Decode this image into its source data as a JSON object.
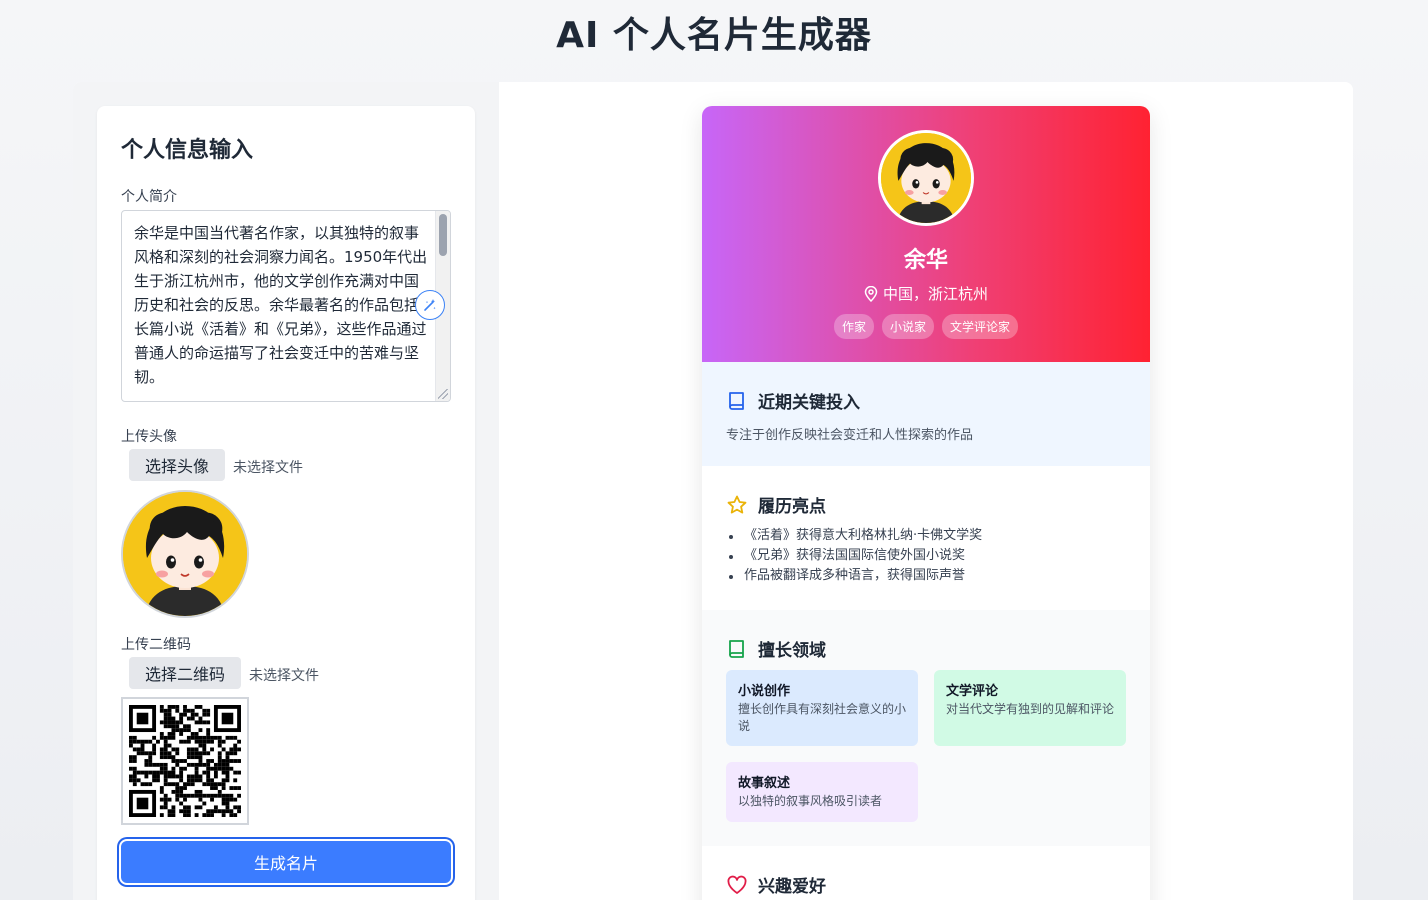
{
  "app": {
    "title": "AI 个人名片生成器"
  },
  "form": {
    "title": "个人信息输入",
    "bio_label": "个人简介",
    "bio_value": "余华是中国当代著名作家，以其独特的叙事风格和深刻的社会洞察力闻名。1950年代出生于浙江杭州市，他的文学创作充满对中国历史和社会的反思。余华最著名的作品包括长篇小说《活着》和《兄弟》，这些作品通过普通人的命运描写了社会变迁中的苦难与坚韧。",
    "avatar_label": "上传头像",
    "avatar_button": "选择头像",
    "avatar_status": "未选择文件",
    "qr_label": "上传二维码",
    "qr_button": "选择二维码",
    "qr_status": "未选择文件",
    "generate_button": "生成名片"
  },
  "card": {
    "name": "余华",
    "location": "中国，浙江杭州",
    "tags": [
      "作家",
      "小说家",
      "文学评论家"
    ],
    "focus": {
      "title": "近期关键投入",
      "text": "专注于创作反映社会变迁和人性探索的作品"
    },
    "highlights": {
      "title": "履历亮点",
      "items": [
        "《活着》获得意大利格林扎纳·卡佛文学奖",
        "《兄弟》获得法国国际信使外国小说奖",
        "作品被翻译成多种语言，获得国际声誉"
      ]
    },
    "skills": {
      "title": "擅长领域",
      "items": [
        {
          "name": "小说创作",
          "desc": "擅长创作具有深刻社会意义的小说"
        },
        {
          "name": "文学评论",
          "desc": "对当代文学有独到的见解和评论"
        },
        {
          "name": "故事叙述",
          "desc": "以独特的叙事风格吸引读者"
        }
      ]
    },
    "hobbies": {
      "title": "兴趣爱好"
    }
  },
  "colors": {
    "primary_button": "#3b7cff",
    "header_gradient": [
      "#c766f8",
      "#ef4076",
      "#ff2232"
    ],
    "focus_bg": "#eff6ff",
    "skill_blue": "#dbeafe",
    "skill_green": "#d1fae5",
    "skill_purple": "#f3e8ff"
  },
  "icons": [
    "magic-wand-icon",
    "location-pin-icon",
    "book-icon",
    "star-icon",
    "book-green-icon",
    "heart-icon"
  ]
}
